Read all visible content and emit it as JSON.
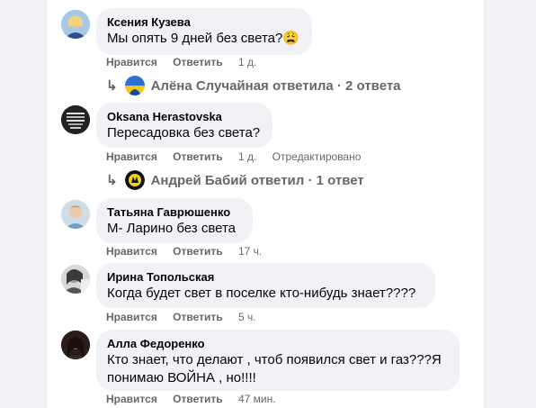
{
  "comments": [
    {
      "author": "Ксения Кузева",
      "text": "Мы опять 9 дней без света?😩",
      "like": "Нравится",
      "reply": "Ответить",
      "time": "1 д.",
      "replies": "Алёна Случайная ответила · 2 ответа"
    },
    {
      "author": "Oksana Herastovska",
      "text": "Пересадовка без света?",
      "like": "Нравится",
      "reply": "Ответить",
      "time": "1 д.",
      "edited": "Отредактировано",
      "replies": "Андрей Бабий ответил · 1 ответ"
    },
    {
      "author": "Татьяна Гаврюшенко",
      "text": "М- Ларино без света",
      "like": "Нравится",
      "reply": "Ответить",
      "time": "17 ч."
    },
    {
      "author": "Ирина Топольская",
      "text": "Когда будет свет в поселке кто-нибудь знает????",
      "like": "Нравится",
      "reply": "Ответить",
      "time": "5 ч."
    },
    {
      "author": "Алла Федоренко",
      "text_line1": "Кто знает, что делают , чтоб появился свет и газ???Я",
      "text_line2": "понимаю ВОЙНА , но!!!!",
      "like": "Нравится",
      "reply": "Ответить",
      "time": "47 мин."
    }
  ],
  "colors": {
    "background": "#f0f2f5",
    "bubble": "#f0f2f5",
    "secondary_text": "#65676b",
    "primary_text": "#050505"
  }
}
